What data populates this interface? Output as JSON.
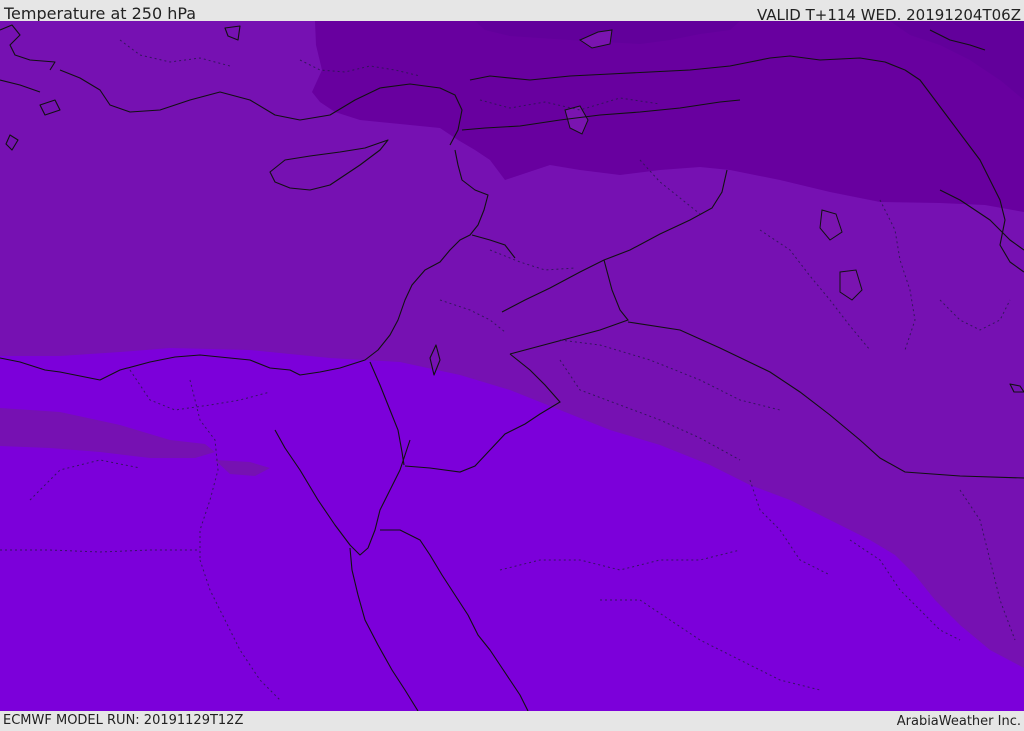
{
  "header": {
    "title": "Temperature at 250 hPa",
    "valid": "VALID T+114 WED. 20191204T06Z"
  },
  "footer": {
    "model_run": "ECMWF MODEL RUN: 20191129T12Z",
    "credit": "ArabiaWeather Inc."
  },
  "map": {
    "variable": "temperature",
    "level": "250 hPa",
    "colors": {
      "darkest": "#62009b",
      "dark": "#68009f",
      "mid": "#7611b2",
      "bright": "#7c00da"
    }
  }
}
